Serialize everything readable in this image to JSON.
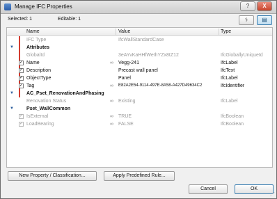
{
  "window": {
    "title": "Manage IFC Properties"
  },
  "titlebar": {
    "help": "?",
    "close": "X"
  },
  "toolbar": {
    "selected": "Selected: 1",
    "editable": "Editable: 1"
  },
  "columns": {
    "name": "Name",
    "value": "Value",
    "type": "Type"
  },
  "rows": [
    {
      "name": "IFC Type",
      "value": "IfcWallStandardCase"
    },
    {
      "name": "Attributes"
    },
    {
      "name": "GlobalId",
      "value": "3eAYvKaHHfWeIhYZx8tZ12",
      "type": "IfcGloballyUniqueId"
    },
    {
      "name": "Name",
      "value": "Vegg-241",
      "type": "IfcLabel"
    },
    {
      "name": "Description",
      "value": "Precast wall panel",
      "type": "IfcText"
    },
    {
      "name": "ObjectType",
      "value": "Panel",
      "type": "IfcLabel"
    },
    {
      "name": "Tag",
      "value": "E82A2E54-9114-497E-8A58-A427D49634C2",
      "type": "IfcIdentifier"
    },
    {
      "name": "AC_Pset_RenovationAndPhasing"
    },
    {
      "name": "Renovation Status",
      "value": "Existing",
      "type": "IfcLabel"
    },
    {
      "name": "Pset_WallCommon"
    },
    {
      "name": "IsExternal",
      "value": "TRUE",
      "type": "IfcBoolean"
    },
    {
      "name": "LoadBearing",
      "value": "FALSE",
      "type": "IfcBoolean"
    }
  ],
  "buttons": {
    "new_property": "New Property / Classification...",
    "apply_rule": "Apply Predefined Rule...",
    "cancel": "Cancel",
    "ok": "OK"
  },
  "icons": {
    "expand": "expand-arrow-icon",
    "link": "chain-link-icon",
    "filter": "filter-icon",
    "view": "view-settings-icon"
  },
  "colors": {
    "accent": "#3c7fb1",
    "required_marker": "#d33b2f",
    "close_button": "#c8442b"
  }
}
